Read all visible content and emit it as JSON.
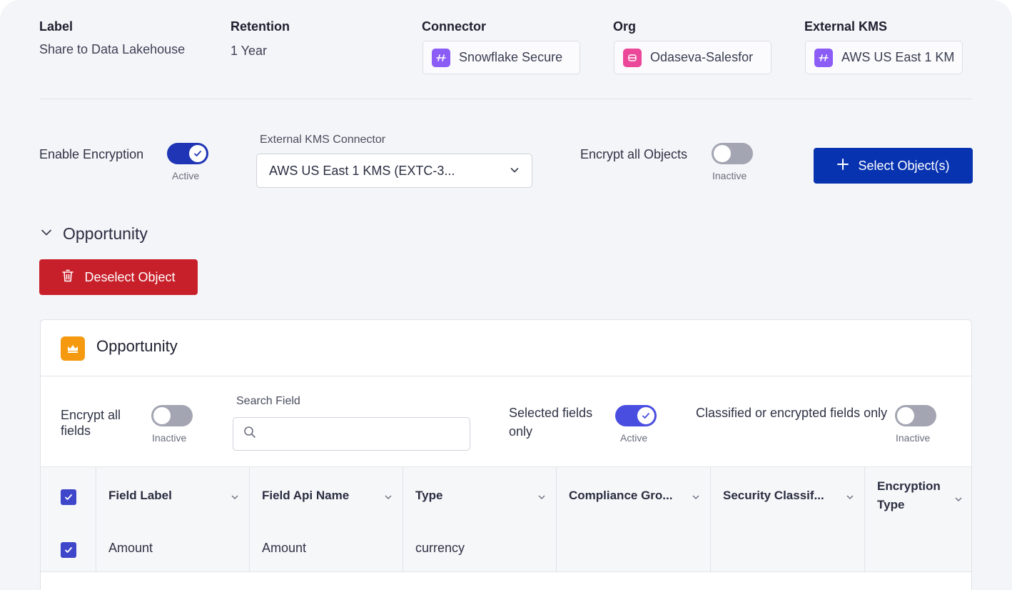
{
  "summary": {
    "label": {
      "title": "Label",
      "value": "Share to Data Lakehouse"
    },
    "retention": {
      "title": "Retention",
      "value": "1 Year"
    },
    "connector": {
      "title": "Connector",
      "value": "Snowflake Secure",
      "icon": "connector-icon",
      "icon_color": "#8b5cf6"
    },
    "org": {
      "title": "Org",
      "value": "Odaseva-Salesfor",
      "icon": "database-icon",
      "icon_color": "#ec4899"
    },
    "external_kms": {
      "title": "External KMS",
      "value": "AWS US East 1 KM",
      "icon": "connector-icon",
      "icon_color": "#8b5cf6"
    }
  },
  "encryption": {
    "enable_label": "Enable Encryption",
    "enable_state": "Active",
    "enable_on": true,
    "kms_connector_label": "External KMS Connector",
    "kms_connector_value": "AWS US East 1 KMS (EXTC-3...",
    "encrypt_all_objects_label": "Encrypt all Objects",
    "encrypt_all_objects_state": "Inactive",
    "encrypt_all_objects_on": false,
    "select_objects_button": "Select Object(s)"
  },
  "section": {
    "title": "Opportunity",
    "expanded": true,
    "deselect_button": "Deselect Object"
  },
  "object_card": {
    "title": "Opportunity",
    "icon": "crown-icon",
    "icon_color": "#f59a10",
    "filters": {
      "encrypt_all_fields_label": "Encrypt all fields",
      "encrypt_all_fields_state": "Inactive",
      "search_label": "Search Field",
      "search_value": "",
      "selected_fields_only_label": "Selected fields only",
      "selected_fields_only_state": "Active",
      "classified_label": "Classified or encrypted fields only",
      "classified_state": "Inactive"
    },
    "table": {
      "columns": [
        "Field Label",
        "Field Api Name",
        "Type",
        "Compliance Gro...",
        "Security Classif...",
        "Encryption Type"
      ],
      "rows": [
        {
          "checked": true,
          "field_label": "Amount",
          "field_api_name": "Amount",
          "type": "currency",
          "compliance_group": "",
          "security_classification": "",
          "encryption_type": ""
        }
      ]
    }
  },
  "colors": {
    "primary": "#0833b0",
    "danger": "#c8202a",
    "toggle_on": "#1f35b5",
    "toggle_off": "#a3a6b2",
    "checkbox": "#3e46c9"
  }
}
